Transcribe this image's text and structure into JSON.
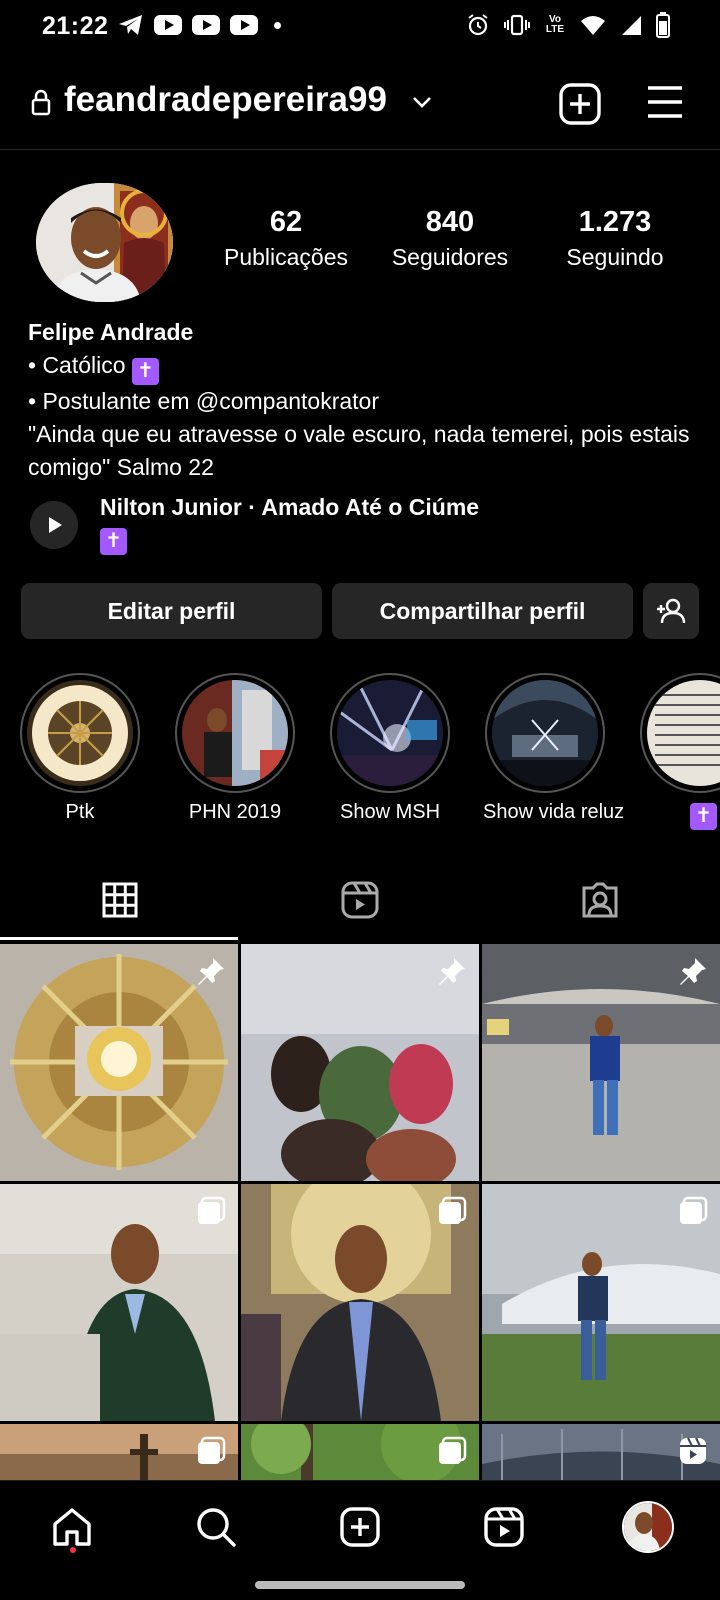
{
  "status_bar": {
    "time": "21:22",
    "icons_left": [
      "telegram-icon",
      "youtube-icon",
      "youtube-icon",
      "youtube-icon",
      "dot-icon"
    ],
    "icons_right": [
      "alarm-icon",
      "vibrate-icon",
      "volte-icon",
      "wifi-icon",
      "signal-icon",
      "battery-icon"
    ],
    "lte_text": "Vo LTE"
  },
  "header": {
    "username": "feandradepereira99"
  },
  "profile": {
    "stats": {
      "posts_count": "62",
      "posts_label": "Publicações",
      "followers_count": "840",
      "followers_label": "Seguidores",
      "following_count": "1.273",
      "following_label": "Seguindo"
    },
    "bio": {
      "name": "Felipe Andrade",
      "line1": "• Católico",
      "line2": "• Postulante em @compantokrator",
      "line3": "\"Ainda que eu atravesse o vale escuro, nada temerei, pois estais comigo\" Salmo 22"
    },
    "music": {
      "title": "Nilton Junior · Amado Até o Ciúme"
    },
    "cross_glyph": "✝"
  },
  "buttons": {
    "edit": "Editar perfil",
    "share": "Compartilhar perfil"
  },
  "highlights": [
    {
      "label": "Ptk"
    },
    {
      "label": "PHN 2019"
    },
    {
      "label": "Show MSH"
    },
    {
      "label": "Show vida reluz"
    },
    {
      "label": "✝"
    }
  ],
  "tabs": [
    "grid-icon",
    "reels-icon",
    "tagged-icon"
  ],
  "grid": {
    "rows": [
      [
        "pinned",
        "pinned",
        "pinned"
      ],
      [
        "carousel",
        "carousel",
        "carousel"
      ],
      [
        "carousel",
        "carousel",
        "reel"
      ]
    ]
  },
  "colors": {
    "background": "#000000",
    "button": "#262626",
    "accent_purple": "#a259ff",
    "notification": "#ff3040"
  }
}
